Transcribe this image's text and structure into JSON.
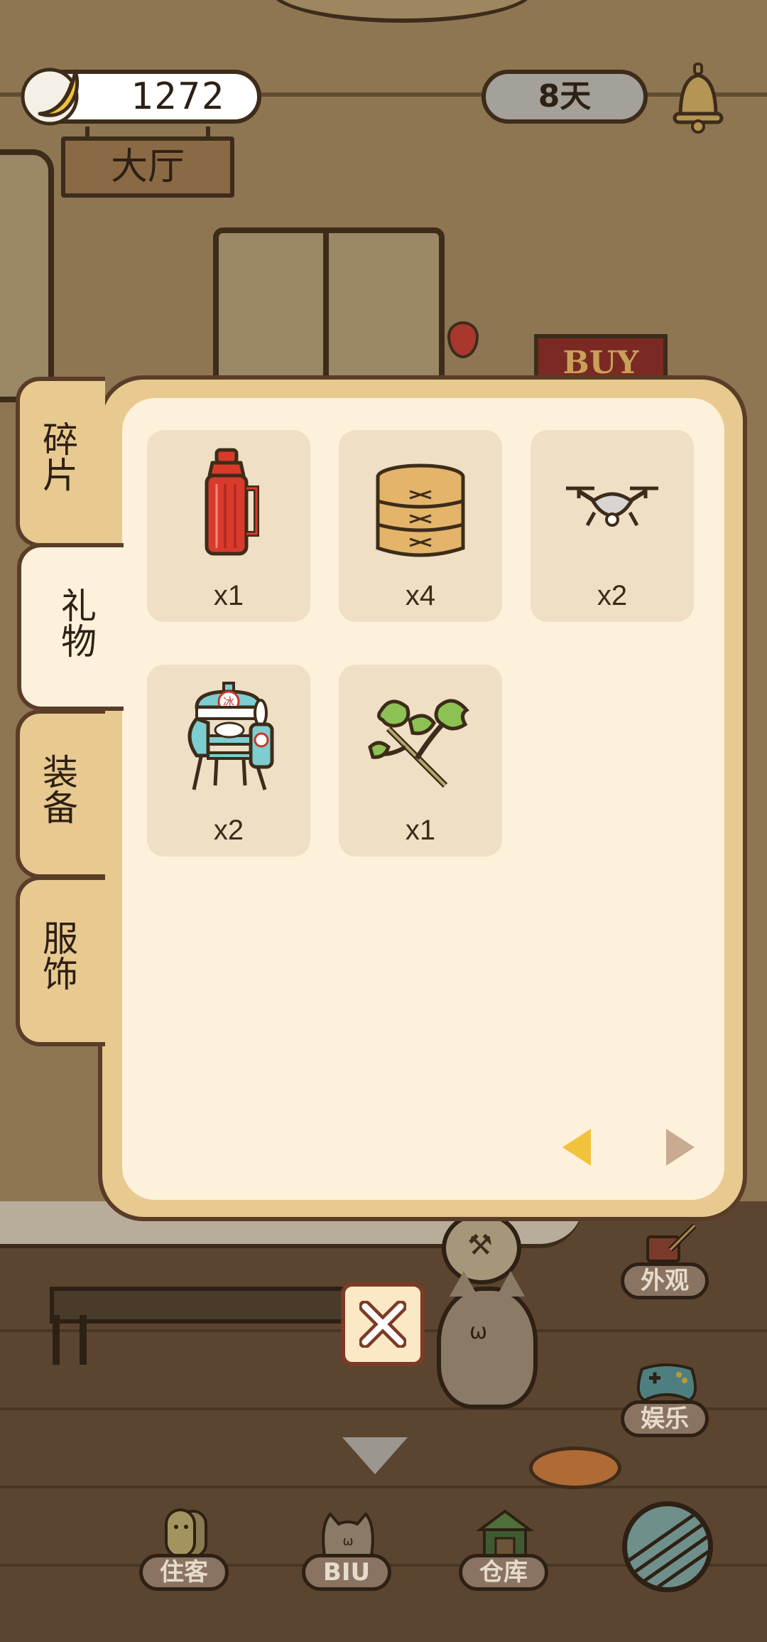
{
  "top_bar": {
    "coins": "1272",
    "room_name": "大厅",
    "days": "8天"
  },
  "background": {
    "buy_sign": "BUY"
  },
  "inventory": {
    "tabs": [
      {
        "id": "fragments",
        "label": "碎片"
      },
      {
        "id": "gift",
        "label": "礼物",
        "selected": true
      },
      {
        "id": "equipment",
        "label": "装备"
      },
      {
        "id": "clothing",
        "label": "服饰"
      }
    ],
    "items": [
      {
        "icon": "thermos-icon",
        "count": "x1"
      },
      {
        "icon": "bamboo-steamer-icon",
        "count": "x4"
      },
      {
        "icon": "drone-icon",
        "count": "x2"
      },
      {
        "icon": "shaved-ice-machine-icon",
        "count": "x2"
      },
      {
        "icon": "herb-branch-icon",
        "count": "x1"
      }
    ]
  },
  "side_buttons": {
    "appearance": "外观",
    "entertainment": "娱乐"
  },
  "bottom_nav": {
    "guests": "住客",
    "biu": "BIU",
    "warehouse": "仓库"
  },
  "colors": {
    "panel_frame": "#e8c990",
    "panel_bg": "#fdf1db",
    "slot_bg": "#eedfc5",
    "prev_arrow": "#f2c23d",
    "next_arrow": "#c9ab91",
    "thermos_red": "#d83a2c",
    "close_border": "#7b3b24"
  }
}
